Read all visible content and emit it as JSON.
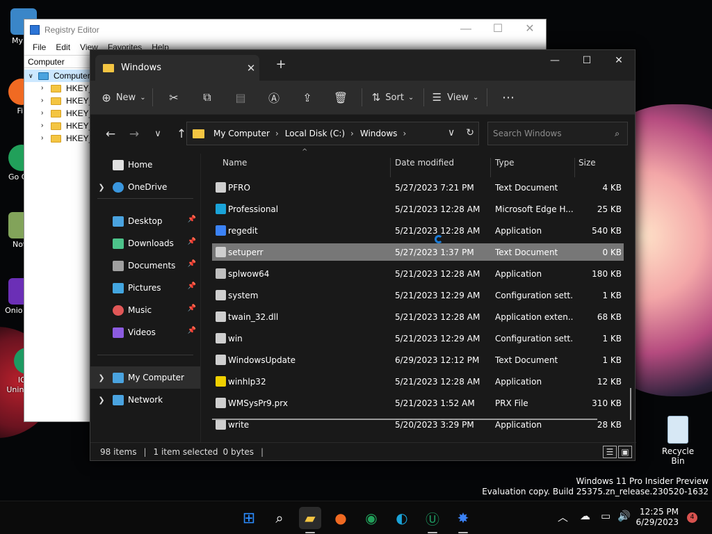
{
  "registry": {
    "title": "Registry Editor",
    "menu": [
      "File",
      "Edit",
      "View",
      "Favorites",
      "Help"
    ],
    "address": "Computer",
    "tree": [
      "Computer",
      "HKEY_C",
      "HKEY_C",
      "HKEY_L",
      "HKEY_U",
      "HKEY_C"
    ]
  },
  "explorer": {
    "tab": "Windows",
    "cmd": {
      "new": "New",
      "sort": "Sort",
      "view": "View"
    },
    "breadcrumb": [
      "My Computer",
      "Local Disk (C:)",
      "Windows"
    ],
    "search_placeholder": "Search Windows",
    "columns": [
      "Name",
      "Date modified",
      "Type",
      "Size"
    ],
    "nav": [
      {
        "label": "Home",
        "color": "#e0e0e0"
      },
      {
        "label": "OneDrive",
        "color": "#3a96dd",
        "arrow": true
      },
      {
        "label": "Desktop",
        "color": "#4aa3df",
        "pin": true
      },
      {
        "label": "Downloads",
        "color": "#4cc38a",
        "pin": true
      },
      {
        "label": "Documents",
        "color": "#a0a0a0",
        "pin": true
      },
      {
        "label": "Pictures",
        "color": "#43a6e0",
        "pin": true
      },
      {
        "label": "Music",
        "color": "#e05757",
        "pin": true
      },
      {
        "label": "Videos",
        "color": "#8c5be0",
        "pin": true
      },
      {
        "label": "My Computer",
        "color": "#4aa3df",
        "arrow": true
      },
      {
        "label": "Network",
        "color": "#4aa3df",
        "arrow": true
      }
    ],
    "files": [
      {
        "name": "PFRO",
        "date": "5/27/2023 7:21 PM",
        "type": "Text Document",
        "size": "4 KB",
        "color": "#cfcfcf"
      },
      {
        "name": "Professional",
        "date": "5/21/2023 12:28 AM",
        "type": "Microsoft Edge H...",
        "size": "25 KB",
        "color": "#1aa3d8"
      },
      {
        "name": "regedit",
        "date": "5/21/2023 12:28 AM",
        "type": "Application",
        "size": "540 KB",
        "color": "#3b82f6"
      },
      {
        "name": "setuperr",
        "date": "5/27/2023 1:37 PM",
        "type": "Text Document",
        "size": "0 KB",
        "color": "#cfcfcf"
      },
      {
        "name": "splwow64",
        "date": "5/21/2023 12:28 AM",
        "type": "Application",
        "size": "180 KB",
        "color": "#bfbfbf"
      },
      {
        "name": "system",
        "date": "5/21/2023 12:29 AM",
        "type": "Configuration sett...",
        "size": "1 KB",
        "color": "#cfcfcf"
      },
      {
        "name": "twain_32.dll",
        "date": "5/21/2023 12:28 AM",
        "type": "Application exten...",
        "size": "68 KB",
        "color": "#cfcfcf"
      },
      {
        "name": "win",
        "date": "5/21/2023 12:29 AM",
        "type": "Configuration sett...",
        "size": "1 KB",
        "color": "#cfcfcf"
      },
      {
        "name": "WindowsUpdate",
        "date": "6/29/2023 12:12 PM",
        "type": "Text Document",
        "size": "1 KB",
        "color": "#cfcfcf"
      },
      {
        "name": "winhlp32",
        "date": "5/21/2023 12:28 AM",
        "type": "Application",
        "size": "12 KB",
        "color": "#f0d000"
      },
      {
        "name": "WMSysPr9.prx",
        "date": "5/21/2023 1:52 AM",
        "type": "PRX File",
        "size": "310 KB",
        "color": "#cfcfcf"
      },
      {
        "name": "write",
        "date": "5/20/2023 3:29 PM",
        "type": "Application",
        "size": "28 KB",
        "color": "#cfcfcf"
      }
    ],
    "status": {
      "items": "98 items",
      "selected": "1 item selected",
      "bytes": "0 bytes"
    }
  },
  "desktop": {
    "icons": [
      "My Co",
      "Fir",
      "Go Chr",
      "Note",
      "Onio Cor",
      "IObit Uninstaller"
    ],
    "recycle": "Recycle Bin",
    "watermark1": "Windows 11 Pro Insider Preview",
    "watermark2": "Evaluation copy. Build 25375.zn_release.230520-1632"
  },
  "taskbar": {
    "time": "12:25 PM",
    "date": "6/29/2023",
    "badge": "4"
  }
}
